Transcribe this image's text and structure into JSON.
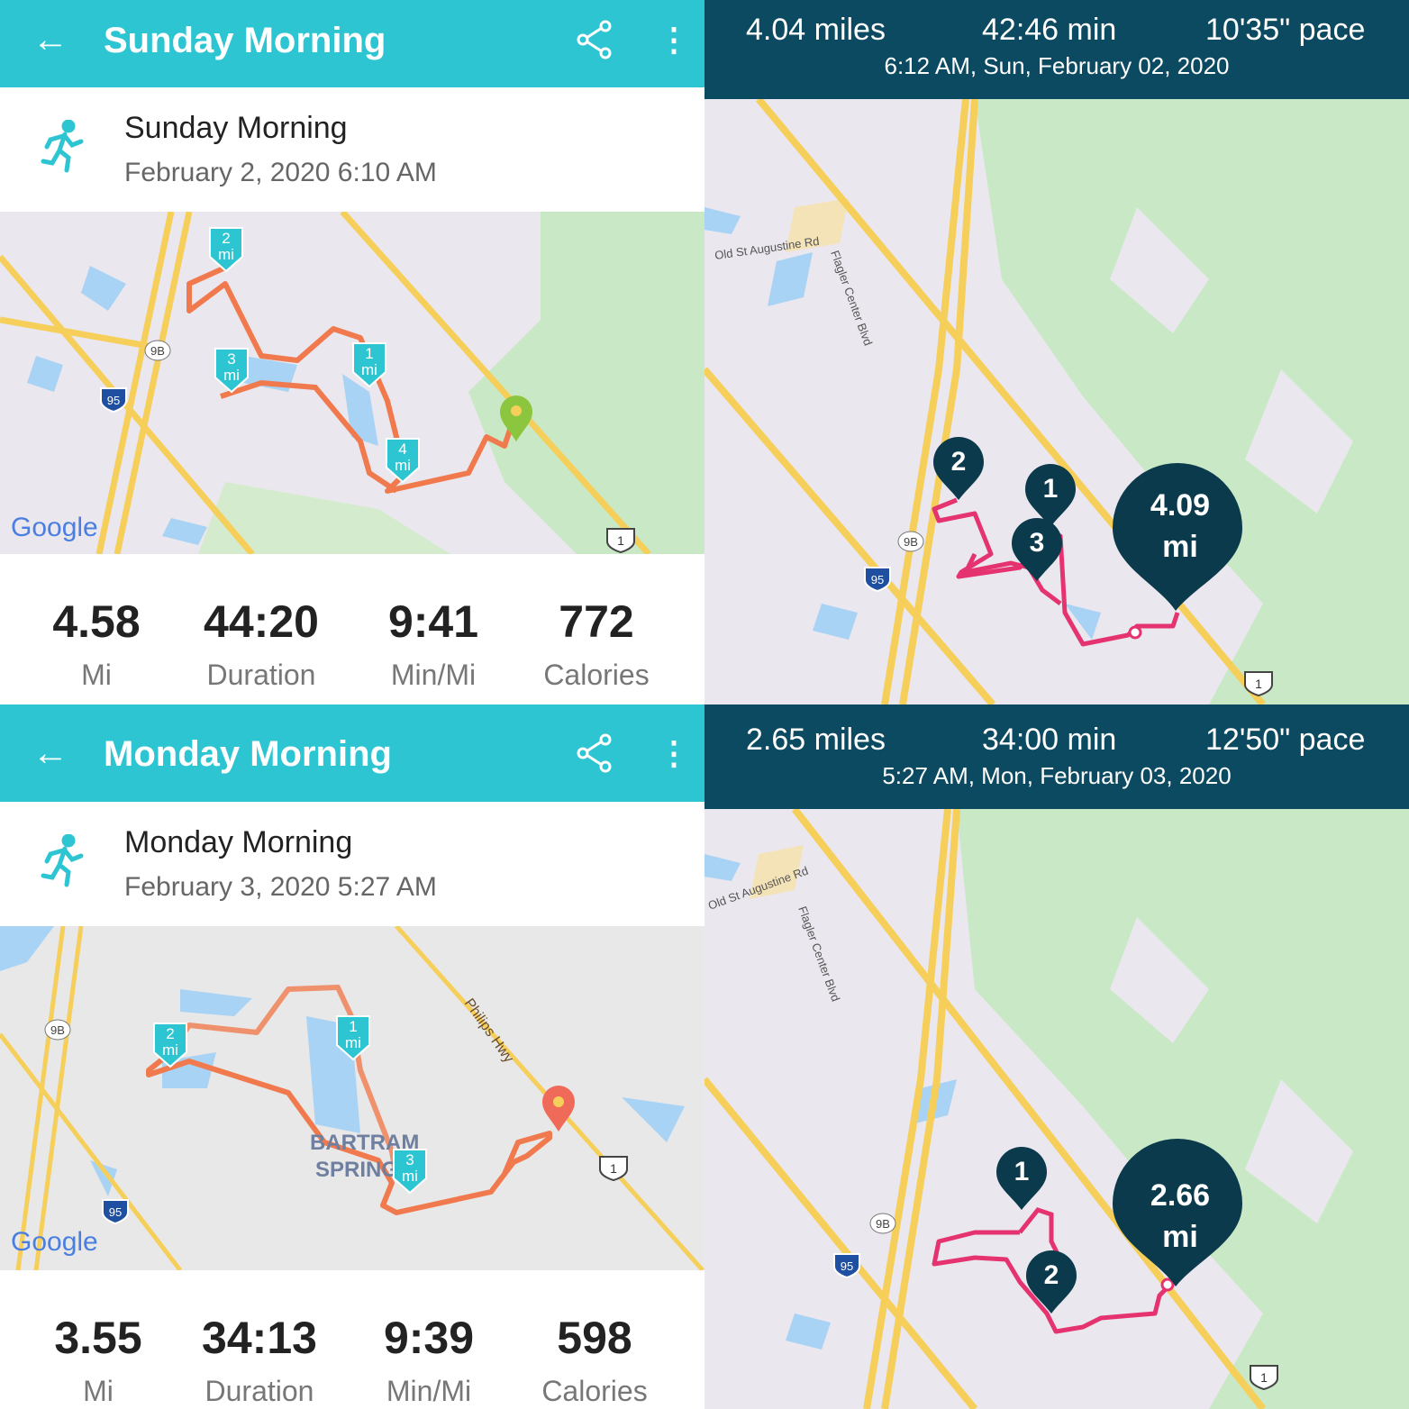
{
  "colors": {
    "fitbit_teal": "#2ec5d3",
    "dark_header": "#0b4a60",
    "route_orange": "#f07a4d",
    "route_pink": "#e5336f",
    "marker_teal": "#2ec5d3",
    "marker_dark": "#0b3a4c"
  },
  "panels": [
    {
      "header": {
        "back_icon": "arrow-left",
        "title": "Sunday Morning",
        "share_icon": "share",
        "more_icon": "more-vertical"
      },
      "activity": {
        "icon": "running-figure",
        "name": "Sunday Morning",
        "date": "February 2, 2020 6:10 AM"
      },
      "map": {
        "logo": "Google",
        "markers": [
          "1\nmi",
          "2\nmi",
          "3\nmi",
          "4\nmi"
        ],
        "m1": "1",
        "m2": "2",
        "m3": "3",
        "m4": "4",
        "unit": "mi",
        "shields": {
          "i95": "95",
          "r9b": "9B",
          "us1": "1"
        }
      },
      "stats": [
        {
          "value": "4.58",
          "label": "Mi"
        },
        {
          "value": "44:20",
          "label": "Duration"
        },
        {
          "value": "9:41",
          "label": "Min/Mi"
        },
        {
          "value": "772",
          "label": "Calories"
        }
      ]
    },
    {
      "summary": {
        "distance": "4.04 miles",
        "duration": "42:46 min",
        "pace": "10'35\" pace",
        "datetime": "6:12 AM, Sun, February 02, 2020"
      },
      "map": {
        "roads": [
          "Old St Augustine Rd",
          "Flagler Center Blvd"
        ],
        "markers": [
          "1",
          "2",
          "3"
        ],
        "end_value": "4.09",
        "end_unit": "mi",
        "shields": {
          "i95": "95",
          "r9b": "9B",
          "us1": "1"
        }
      }
    },
    {
      "header": {
        "back_icon": "arrow-left",
        "title": "Monday Morning",
        "share_icon": "share",
        "more_icon": "more-vertical"
      },
      "activity": {
        "icon": "running-figure",
        "name": "Monday Morning",
        "date": "February 3, 2020 5:27 AM"
      },
      "map": {
        "logo": "Google",
        "m1": "1",
        "m2": "2",
        "m3": "3",
        "unit": "mi",
        "road": "Philips Hwy",
        "area_line1": "BARTRAM",
        "area_line2": "SPRINGS",
        "shields": {
          "i95": "95",
          "r9b": "9B",
          "us1": "1"
        }
      },
      "stats": [
        {
          "value": "3.55",
          "label": "Mi"
        },
        {
          "value": "34:13",
          "label": "Duration"
        },
        {
          "value": "9:39",
          "label": "Min/Mi"
        },
        {
          "value": "598",
          "label": "Calories"
        }
      ]
    },
    {
      "summary": {
        "distance": "2.65 miles",
        "duration": "34:00 min",
        "pace": "12'50\" pace",
        "datetime": "5:27 AM, Mon, February 03, 2020"
      },
      "map": {
        "roads": [
          "Old St Augustine Rd",
          "Flagler Center Blvd"
        ],
        "markers": [
          "1",
          "2"
        ],
        "end_value": "2.66",
        "end_unit": "mi",
        "shields": {
          "i95": "95",
          "r9b": "9B",
          "us1": "1"
        }
      }
    }
  ]
}
